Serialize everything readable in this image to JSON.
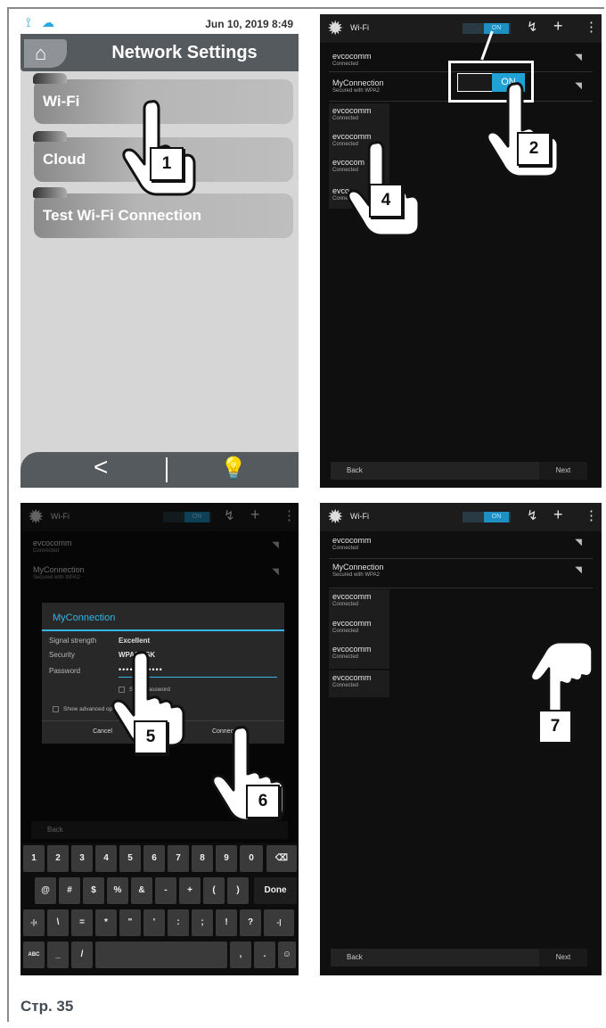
{
  "panel1": {
    "status_date": "Jun 10, 2019",
    "status_time": "8:49",
    "title": "Network Settings",
    "menu": [
      {
        "label": "Wi-Fi"
      },
      {
        "label": "Cloud"
      },
      {
        "label": "Test Wi-Fi Connection"
      }
    ],
    "back_glyph": "<",
    "bulb_glyph": "💡"
  },
  "wifi_screen": {
    "title": "Wi-Fi",
    "toggle": "ON",
    "networks": [
      {
        "name": "evcocomm",
        "status": "Connected"
      },
      {
        "name": "MyConnection",
        "status": "Secured with WPA2"
      },
      {
        "name": "evcocomm",
        "status": "Connected"
      },
      {
        "name": "evcocomm",
        "status": "Connected"
      },
      {
        "name": "evcocomm",
        "status": "Connected"
      },
      {
        "name": "evcocomm",
        "status": "Connected"
      }
    ],
    "back": "Back",
    "next": "Next"
  },
  "panel2": {
    "zoom_toggle": "ON",
    "networks": [
      {
        "name": "evcocomm",
        "status": "Connected"
      },
      {
        "name": "MyConnection",
        "status": "Secured with WPA2"
      },
      {
        "name": "evcocomm",
        "status": "Connected"
      },
      {
        "name": "evcocomm",
        "status": "Connected"
      },
      {
        "name": "evcocom",
        "status": "Connected"
      },
      {
        "name": "evco",
        "status": "Connec"
      }
    ]
  },
  "dialog": {
    "title": "MyConnection",
    "signal_label": "Signal strength",
    "signal_value": "Excellent",
    "security_label": "Security",
    "security_value": "WPA2 PSK",
    "password_label": "Password",
    "password_value": "••••••••••••",
    "show_password": "Show password",
    "advanced": "Show advanced opti",
    "cancel": "Cancel",
    "connect": "Connect"
  },
  "keyboard": {
    "row1": [
      "1",
      "2",
      "3",
      "4",
      "5",
      "6",
      "7",
      "8",
      "9",
      "0",
      "⌫"
    ],
    "row2": [
      "@",
      "#",
      "$",
      "%",
      "&",
      "-",
      "+",
      "(",
      ")",
      "Done"
    ],
    "row3": [
      "-|‹",
      "\\",
      "=",
      "*",
      "\"",
      "'",
      ":",
      ";",
      "!",
      "?",
      "-|"
    ],
    "row4": [
      "ABC",
      "_",
      "/",
      "",
      ",",
      ".",
      "☺"
    ]
  },
  "callouts": [
    "1",
    "2",
    "4",
    "5",
    "6",
    "7"
  ],
  "caption": "Стр. 35",
  "colors": {
    "accent_blue": "#34b5e5",
    "toggle_blue": "#20a3d4",
    "header_grey": "#555a5e",
    "bulb_yellow": "#f3e32b"
  }
}
